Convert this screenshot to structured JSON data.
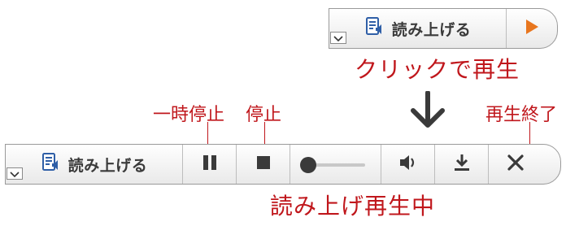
{
  "top_toolbar": {
    "read_label": "読み上げる",
    "icons": {
      "collapse": "chevron-down-icon",
      "speaker_doc": "document-speaker-icon",
      "play": "play-icon"
    },
    "colors": {
      "play": "#e8761e",
      "doc_icon": "#2f5fa7"
    }
  },
  "caption_click": "クリックで再生",
  "callouts": {
    "pause": "一時停止",
    "stop": "停止",
    "close": "再生終了"
  },
  "bottom_toolbar": {
    "read_label": "読み上げる",
    "volume_level": 0.1,
    "icons": {
      "collapse": "chevron-down-icon",
      "speaker_doc": "document-speaker-icon",
      "pause": "pause-icon",
      "stop": "stop-icon",
      "volume": "volume-icon",
      "download": "download-icon",
      "close": "close-icon"
    }
  },
  "caption_playing": "読み上げ再生中",
  "colors": {
    "accent_red": "#c0171c",
    "icon_dark": "#3a3a3a"
  }
}
